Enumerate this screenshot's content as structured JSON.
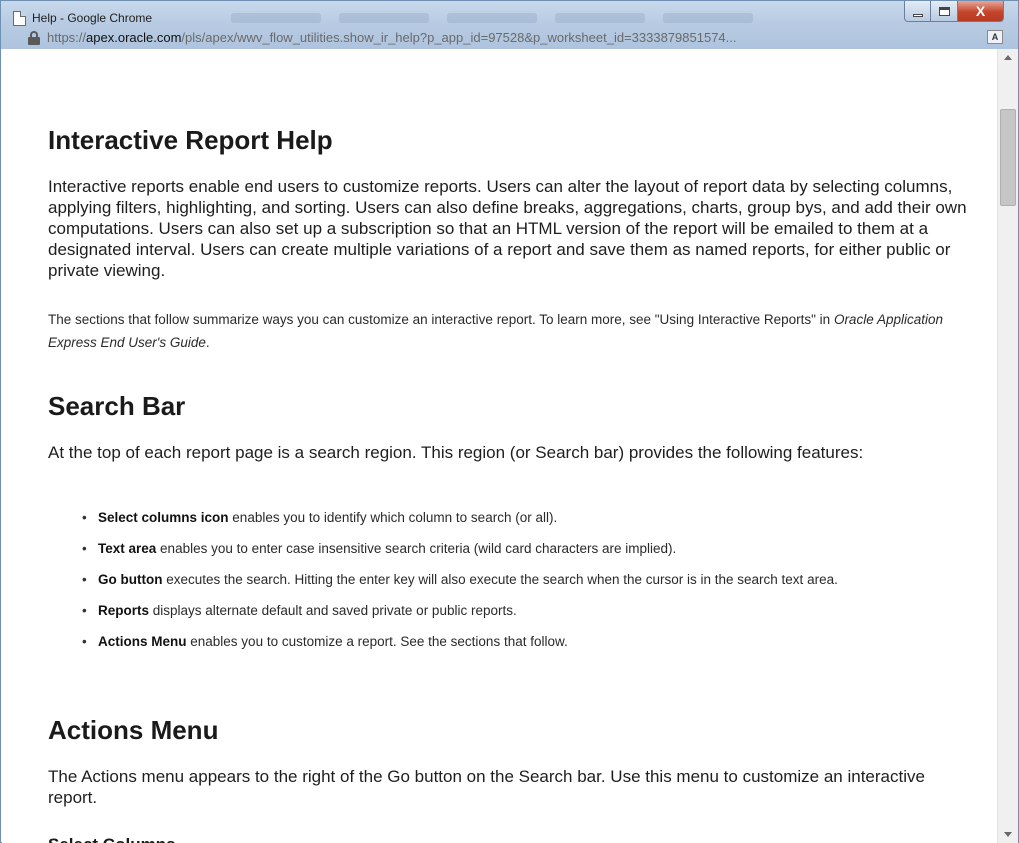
{
  "window": {
    "title": "Help - Google Chrome",
    "controls": {
      "close_glyph": "X"
    }
  },
  "address_bar": {
    "url_prefix": "https://",
    "url_host": "apex.oracle.com",
    "url_rest": "/pls/apex/wwv_flow_utilities.show_ir_help?p_app_id=97528&p_worksheet_id=3333879851574...",
    "translate_glyph": "A"
  },
  "help": {
    "title": "Interactive Report Help",
    "intro": "Interactive reports enable end users to customize reports. Users can alter the layout of report data by selecting columns, applying filters, highlighting, and sorting. Users can also define breaks, aggregations, charts, group bys, and add their own computations. Users can also set up a subscription so that an HTML version of the report will be emailed to them at a designated interval. Users can create multiple variations of a report and save them as named reports, for either public or private viewing.",
    "note_before": "The sections that follow summarize ways you can customize an interactive report. To learn more, see \"Using Interactive Reports\" in ",
    "note_book": "Oracle Application Express End User's Guide",
    "note_after": ".",
    "search_bar": {
      "heading": "Search Bar",
      "description": "At the top of each report page is a search region. This region (or Search bar) provides the following features:",
      "items": [
        {
          "term": "Select columns icon",
          "text": " enables you to identify which column to search (or all)."
        },
        {
          "term": "Text area",
          "text": " enables you to enter case insensitive search criteria (wild card characters are implied)."
        },
        {
          "term": "Go button",
          "text": " executes the search. Hitting the enter key will also execute the search when the cursor is in the search text area."
        },
        {
          "term": "Reports",
          "text": " displays alternate default and saved private or public reports."
        },
        {
          "term": "Actions Menu",
          "text": " enables you to customize a report. See the sections that follow."
        }
      ]
    },
    "actions_menu": {
      "heading": "Actions Menu",
      "description": "The Actions menu appears to the right of the Go button on the Search bar. Use this menu to customize an interactive report.",
      "next_subheading": "Select Columns"
    }
  },
  "colors": {
    "titlebar": "#b8cbe2",
    "close_button": "#c4452b",
    "text": "#1e1e1e"
  }
}
